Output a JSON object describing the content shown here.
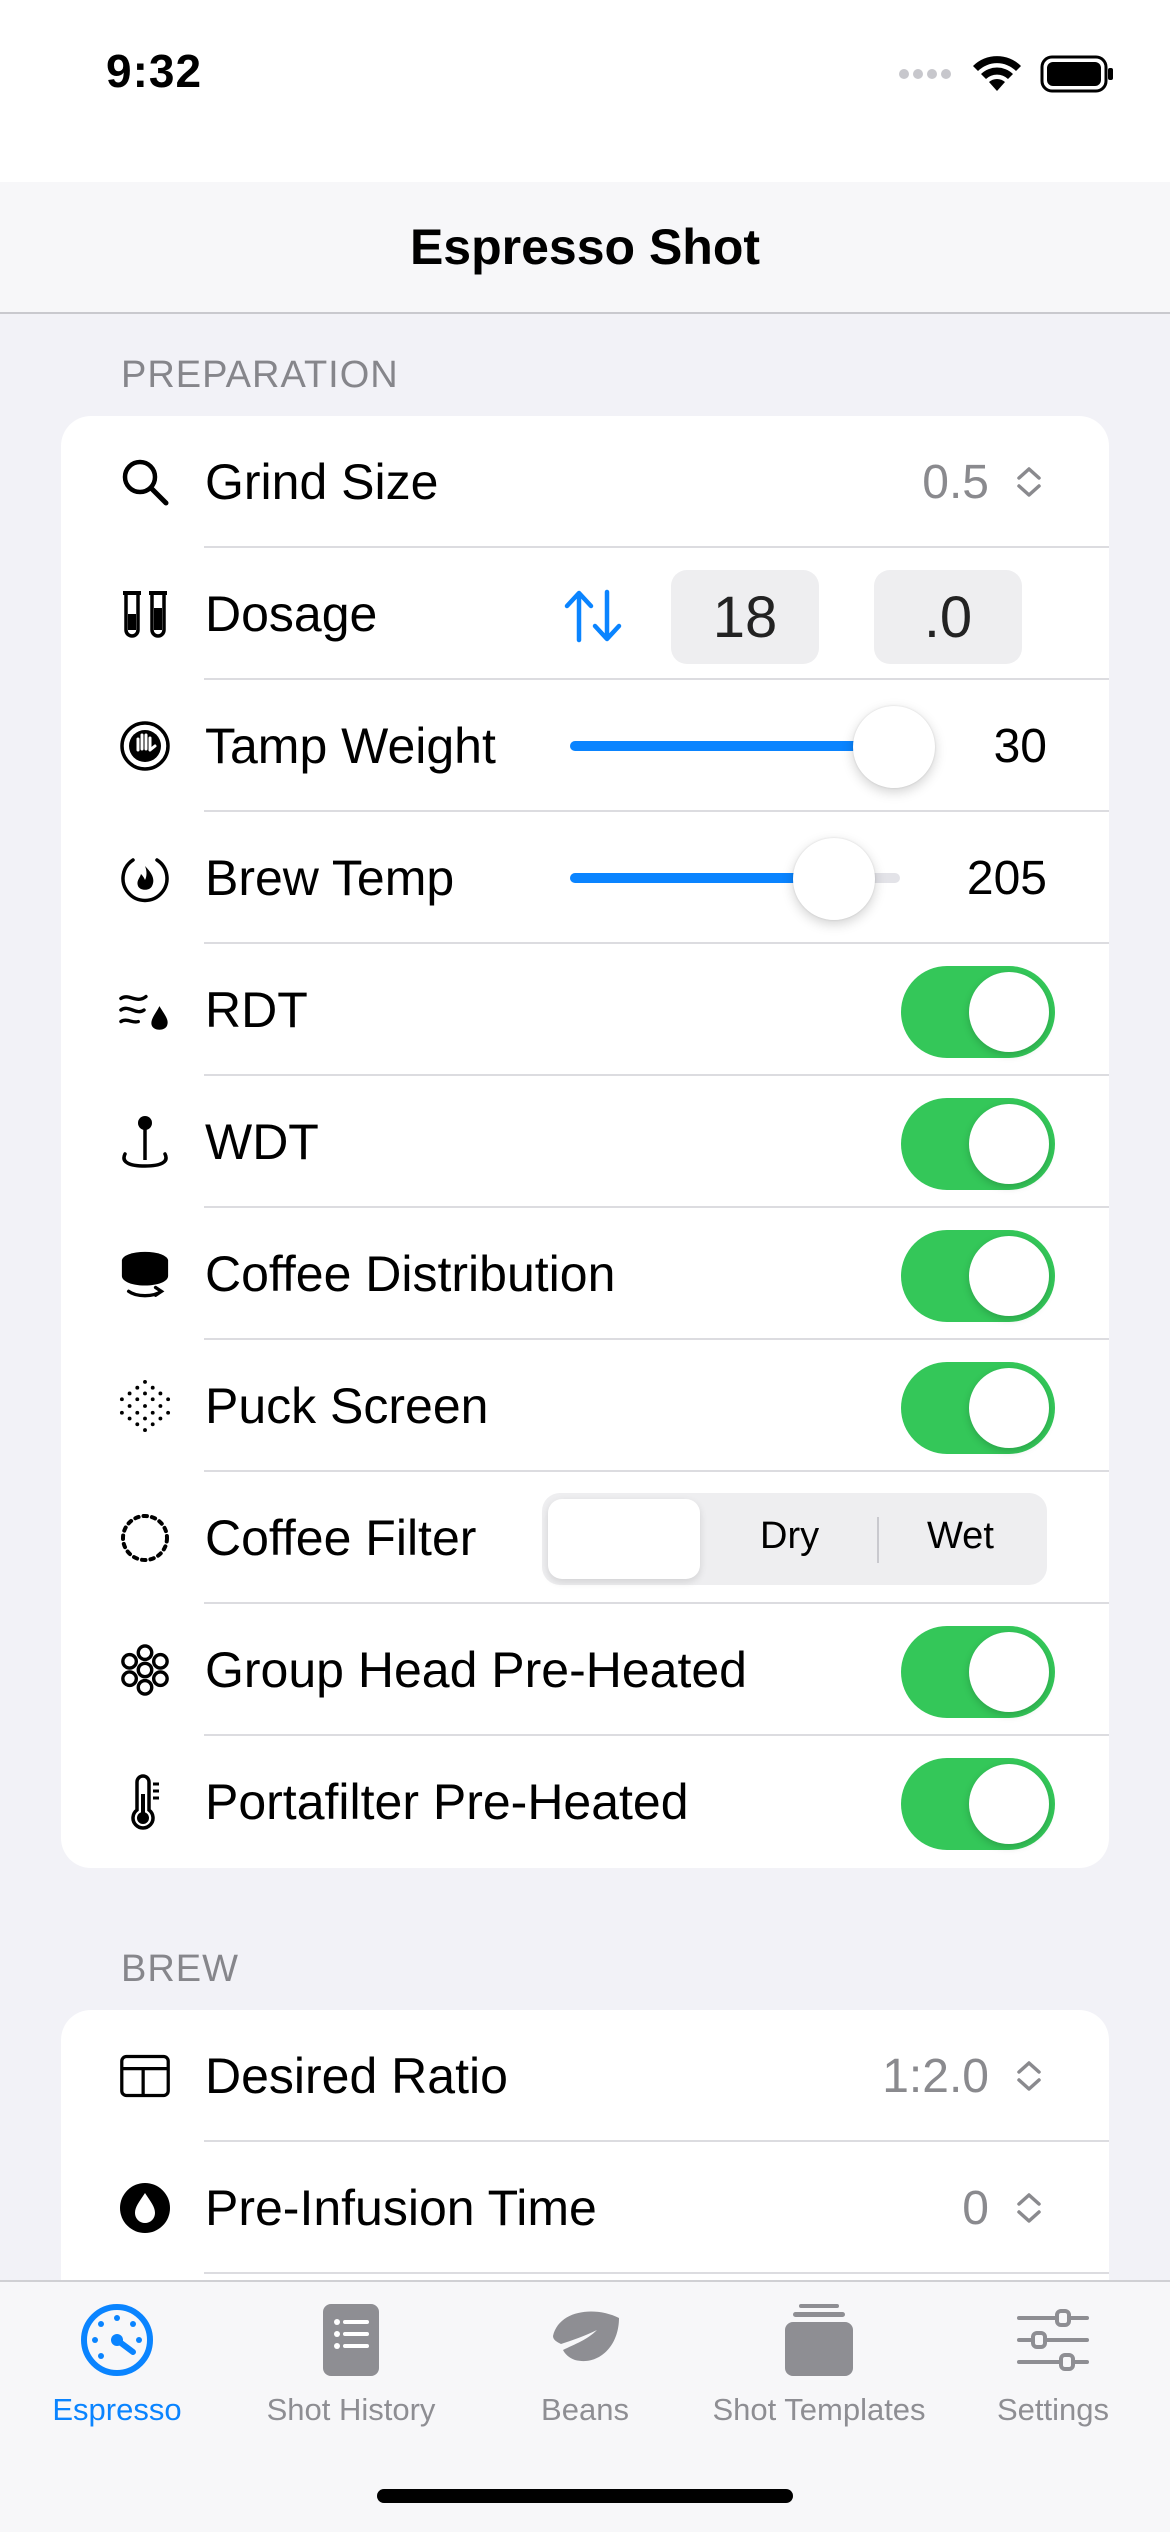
{
  "status": {
    "time": "9:32"
  },
  "nav": {
    "title": "Espresso Shot"
  },
  "preparation": {
    "header": "PREPARATION",
    "grind_size": {
      "label": "Grind Size",
      "value": "0.5",
      "icon": "magnifyingglass-icon"
    },
    "dosage": {
      "label": "Dosage",
      "whole": "18",
      "decimal": ".0",
      "icon": "test-tubes-icon"
    },
    "tamp_weight": {
      "label": "Tamp Weight",
      "value": "30",
      "fraction": 0.9,
      "icon": "hand-circle-icon"
    },
    "brew_temp": {
      "label": "Brew Temp",
      "value": "205",
      "fraction": 0.8,
      "icon": "flame-circle-icon"
    },
    "rdt": {
      "label": "RDT",
      "on": true,
      "icon": "wind-drop-icon"
    },
    "wdt": {
      "label": "WDT",
      "on": true,
      "icon": "needle-tool-icon"
    },
    "distribution": {
      "label": "Coffee Distribution",
      "on": true,
      "icon": "distributor-icon"
    },
    "puck_screen": {
      "label": "Puck Screen",
      "on": true,
      "icon": "dot-grid-icon"
    },
    "coffee_filter": {
      "label": "Coffee Filter",
      "options": [
        "",
        "Dry",
        "Wet"
      ],
      "selected_index": 0,
      "icon": "dotted-circle-icon"
    },
    "group_head": {
      "label": "Group Head Pre-Heated",
      "on": true,
      "icon": "flower-dots-icon"
    },
    "portafilter": {
      "label": "Portafilter Pre-Heated",
      "on": true,
      "icon": "thermometer-icon"
    }
  },
  "brew": {
    "header": "BREW",
    "desired_ratio": {
      "label": "Desired Ratio",
      "value": "1:2.0",
      "icon": "ratio-rectangle-icon"
    },
    "pre_infusion": {
      "label": "Pre-Infusion Time",
      "value": "0",
      "icon": "drop-circle-icon"
    }
  },
  "tabs": [
    {
      "label": "Espresso",
      "active": true,
      "icon": "gauge-icon"
    },
    {
      "label": "Shot History",
      "active": false,
      "icon": "list-document-icon"
    },
    {
      "label": "Beans",
      "active": false,
      "icon": "leaf-icon"
    },
    {
      "label": "Shot Templates",
      "active": false,
      "icon": "stacked-tray-icon"
    },
    {
      "label": "Settings",
      "active": false,
      "icon": "sliders-icon"
    }
  ],
  "colors": {
    "accent": "#0a84ff",
    "toggle_on": "#34c759",
    "secondary_text": "#8a8a8e"
  }
}
